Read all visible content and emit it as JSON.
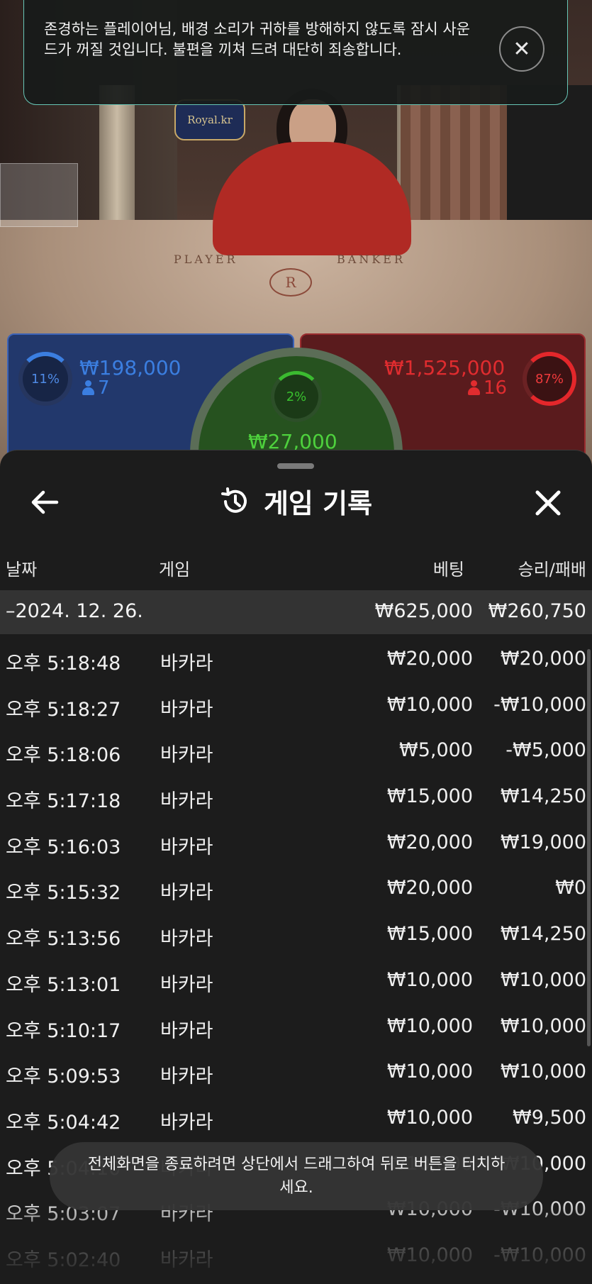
{
  "notice": {
    "message": "존경하는 플레이어님, 배경 소리가 귀하를 방해하지 않도록 잠시 사운드가 꺼질 것입니다. 불편을 끼쳐 드려 대단히 죄송합니다."
  },
  "stream": {
    "logo_text": "Royal.kr",
    "table_player": "PLAYER",
    "table_banker": "BANKER",
    "crest": "R"
  },
  "betting": {
    "player": {
      "percent": "11%",
      "amount": "₩198,000",
      "players": "7",
      "color": "#3b7ee0"
    },
    "tie": {
      "percent": "2%",
      "amount": "₩27,000",
      "color": "#3bbb30"
    },
    "banker": {
      "percent": "87%",
      "amount": "₩1,525,000",
      "players": "16",
      "color": "#e4272b"
    }
  },
  "history": {
    "title": "게임 기록",
    "back_icon": "arrow-left-icon",
    "history_icon": "history-clock-icon",
    "close_icon": "close-icon",
    "columns": {
      "date": "날짜",
      "game": "게임",
      "bet": "베팅",
      "result": "승리/패배"
    },
    "group": {
      "date": "–2024. 12. 26.",
      "bet_total": "₩625,000",
      "result_total": "₩260,750"
    },
    "rows": [
      {
        "time": "오후 5:18:48",
        "game": "바카라",
        "bet": "₩20,000",
        "result": "₩20,000"
      },
      {
        "time": "오후 5:18:27",
        "game": "바카라",
        "bet": "₩10,000",
        "result": "-₩10,000"
      },
      {
        "time": "오후 5:18:06",
        "game": "바카라",
        "bet": "₩5,000",
        "result": "-₩5,000"
      },
      {
        "time": "오후 5:17:18",
        "game": "바카라",
        "bet": "₩15,000",
        "result": "₩14,250"
      },
      {
        "time": "오후 5:16:03",
        "game": "바카라",
        "bet": "₩20,000",
        "result": "₩19,000"
      },
      {
        "time": "오후 5:15:32",
        "game": "바카라",
        "bet": "₩20,000",
        "result": "₩0"
      },
      {
        "time": "오후 5:13:56",
        "game": "바카라",
        "bet": "₩15,000",
        "result": "₩14,250"
      },
      {
        "time": "오후 5:13:01",
        "game": "바카라",
        "bet": "₩10,000",
        "result": "₩10,000"
      },
      {
        "time": "오후 5:10:17",
        "game": "바카라",
        "bet": "₩10,000",
        "result": "₩10,000"
      },
      {
        "time": "오후 5:09:53",
        "game": "바카라",
        "bet": "₩10,000",
        "result": "₩10,000"
      },
      {
        "time": "오후 5:04:42",
        "game": "바카라",
        "bet": "₩10,000",
        "result": "₩9,500"
      },
      {
        "time": "오후 5:04:10",
        "game": "바카라",
        "bet": "₩10,000",
        "result": "₩10,000"
      },
      {
        "time": "오후 5:03:07",
        "game": "바카라",
        "bet": "₩10,000",
        "result": "-₩10,000"
      },
      {
        "time": "오후 5:02:40",
        "game": "바카라",
        "bet": "₩10,000",
        "result": "-₩10,000"
      }
    ]
  },
  "toast": {
    "message": "전체화면을 종료하려면 상단에서 드래그하여 뒤로 버튼을 터치하세요."
  }
}
